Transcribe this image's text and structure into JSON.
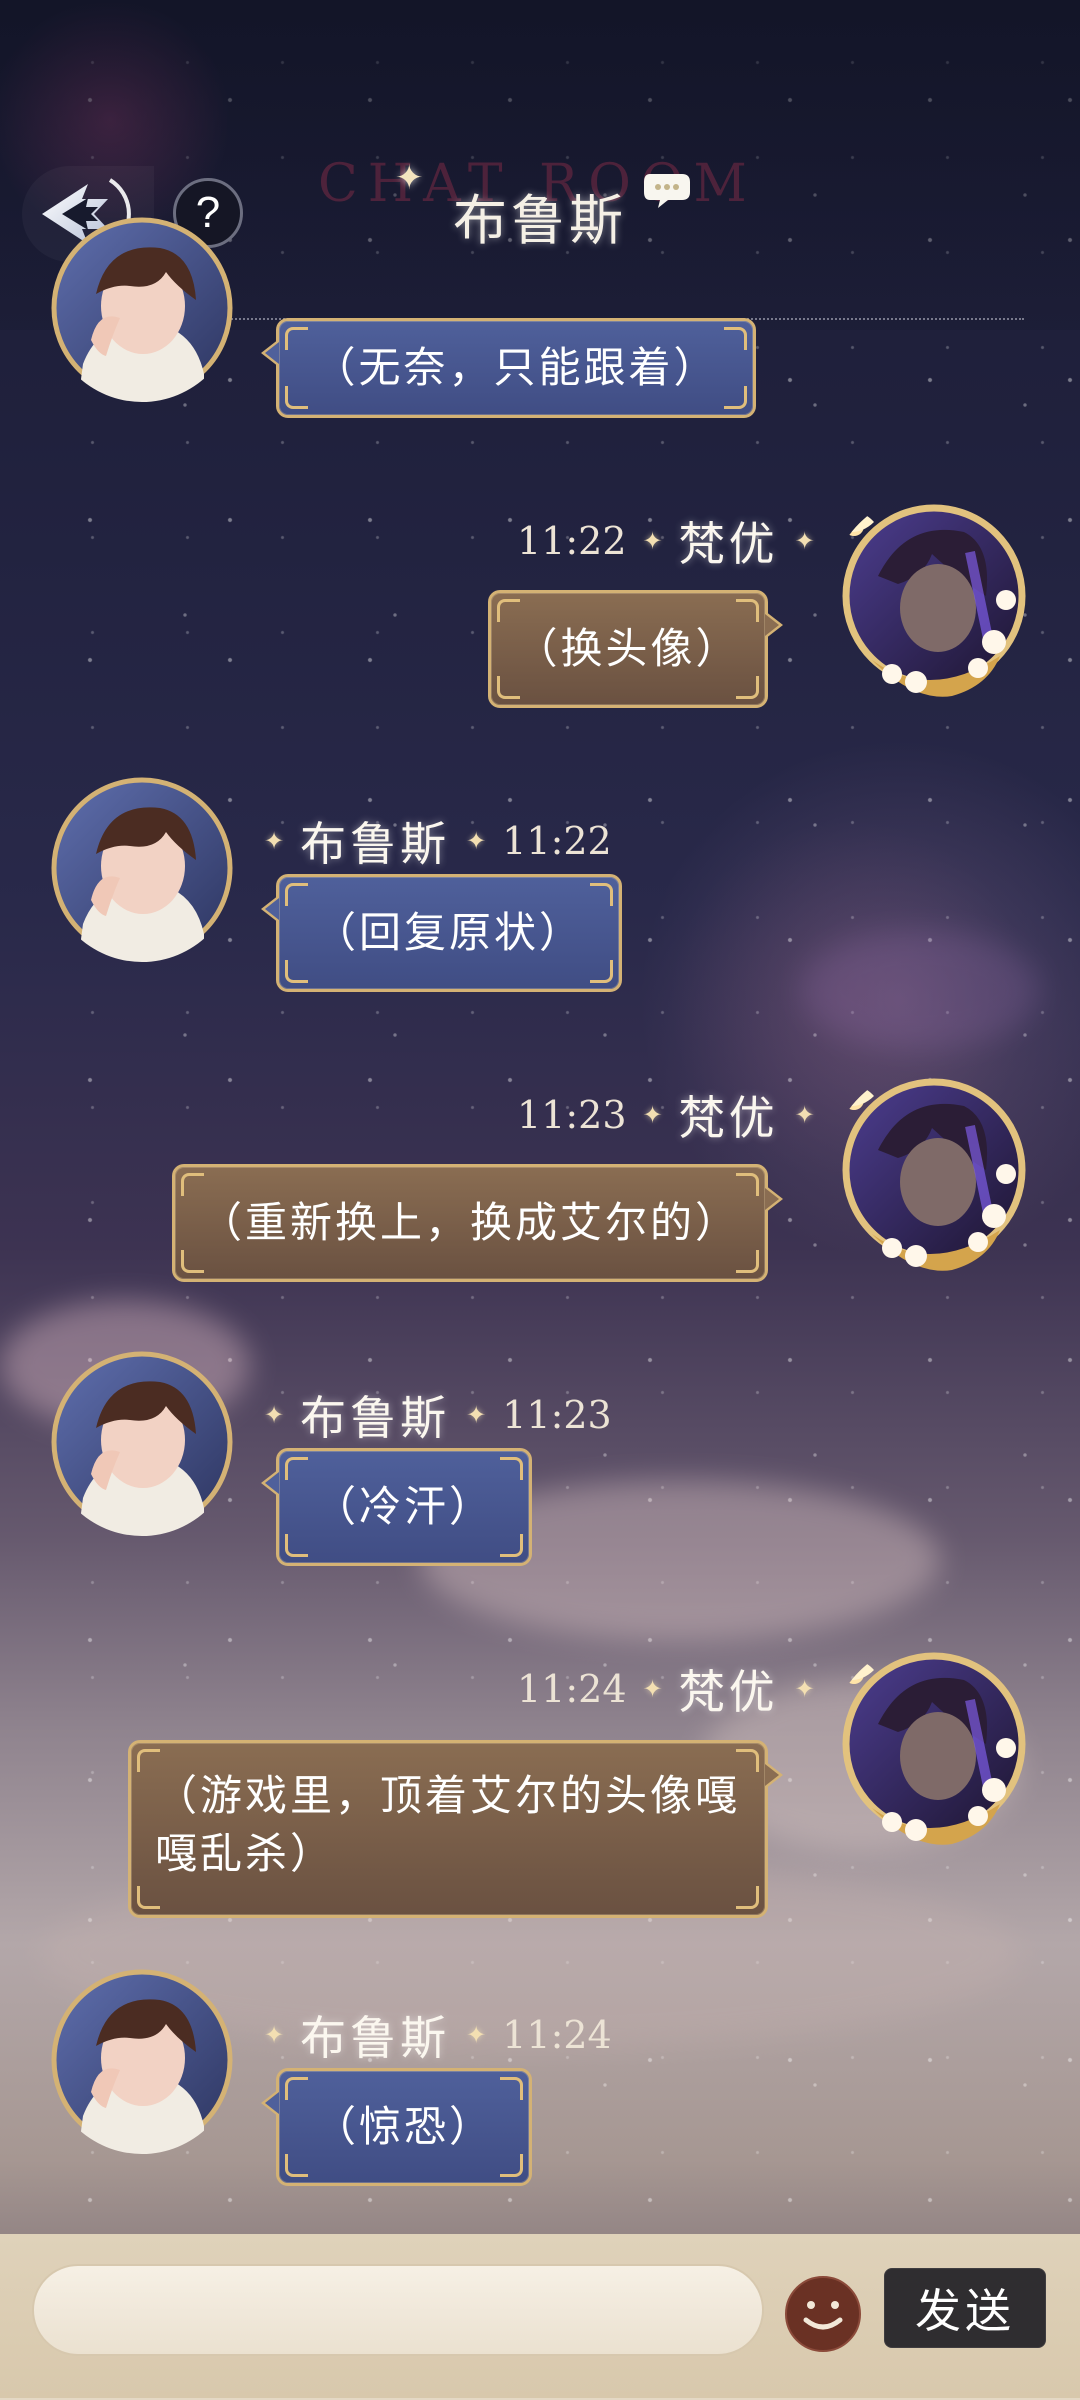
{
  "header": {
    "title": "布鲁斯",
    "watermark": "CHAT ROOM",
    "help_label": "?",
    "icons": {
      "back": "back-arrow-icon",
      "help": "help-icon",
      "sparkle": "sparkle-icon",
      "chat_bubble": "chat-bubble-icon"
    }
  },
  "messages": [
    {
      "sender": "布鲁斯",
      "time": "",
      "text": "（无奈，只能跟着）",
      "side": "left"
    },
    {
      "sender": "梵优",
      "time": "11:22",
      "text": "（换头像）",
      "side": "right"
    },
    {
      "sender": "布鲁斯",
      "time": "11:22",
      "text": "（回复原状）",
      "side": "left"
    },
    {
      "sender": "梵优",
      "time": "11:23",
      "text": "（重新换上，换成艾尔的）",
      "side": "right"
    },
    {
      "sender": "布鲁斯",
      "time": "11:23",
      "text": "（冷汗）",
      "side": "left"
    },
    {
      "sender": "梵优",
      "time": "11:24",
      "text": "（游戏里，顶着艾尔的头像嘎嘎乱杀）",
      "side": "right"
    },
    {
      "sender": "布鲁斯",
      "time": "11:24",
      "text": "（惊恐）",
      "side": "left"
    }
  ],
  "composer": {
    "input_value": "",
    "placeholder": "",
    "emoji_icon": "emoji-icon",
    "send_label": "发送"
  }
}
